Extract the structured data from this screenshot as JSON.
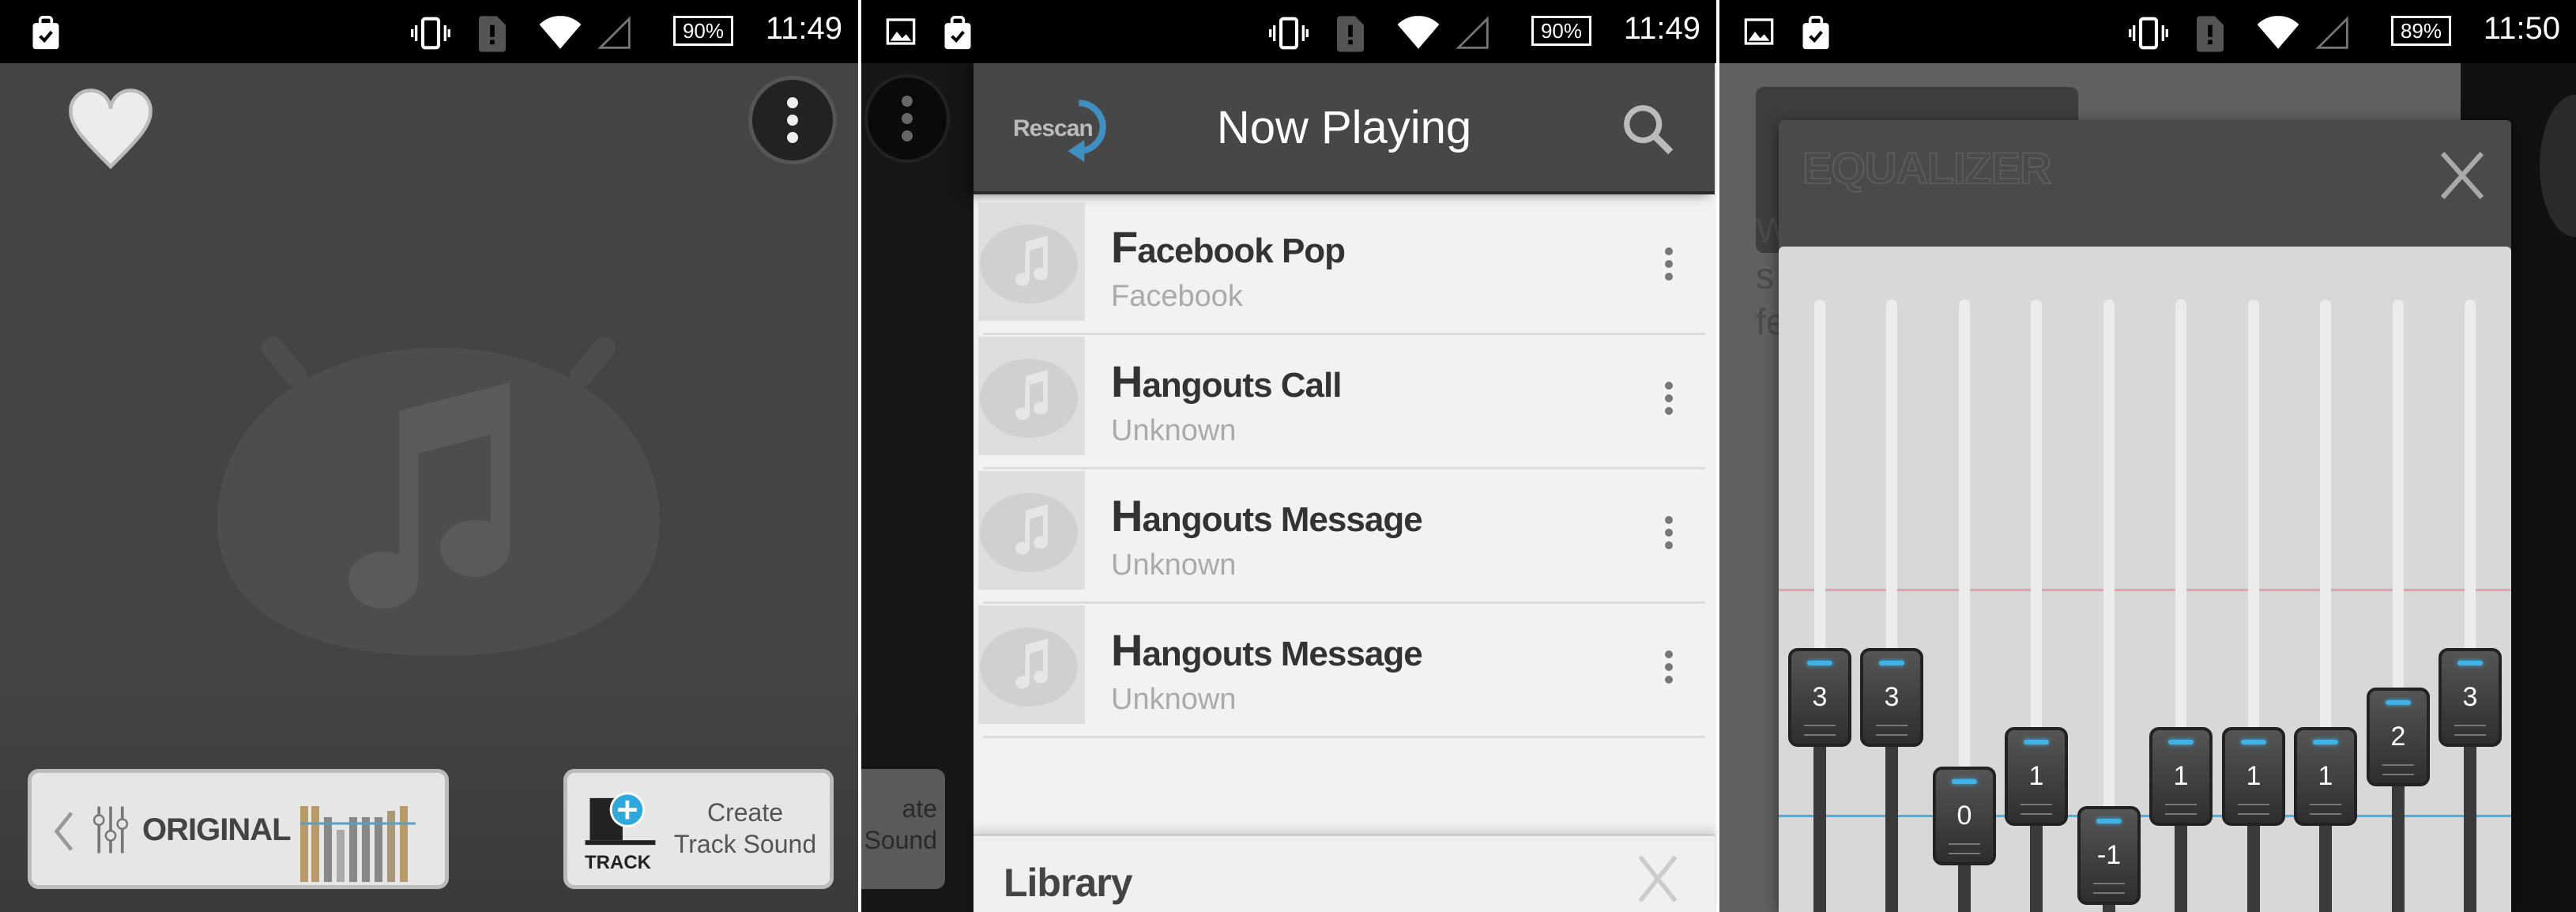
{
  "panels": [
    {
      "status": {
        "time": "11:49",
        "battery": "90%",
        "left_icons": [
          "clipboard-check-icon"
        ]
      }
    },
    {
      "status": {
        "time": "11:49",
        "battery": "90%",
        "left_icons": [
          "image-icon",
          "clipboard-check-icon"
        ]
      }
    },
    {
      "status": {
        "time": "11:50",
        "battery": "89%",
        "left_icons": [
          "image-icon",
          "clipboard-check-icon"
        ]
      }
    }
  ],
  "player": {
    "eq_preset": "ORIGINAL",
    "create_track_line1": "Create",
    "create_track_line2": "Track Sound",
    "track_badge": "TRACK",
    "ghost_line1": "ate",
    "ghost_line2": "Sound"
  },
  "now_playing": {
    "title": "Now Playing",
    "rescan": "Rescan",
    "tracks": [
      {
        "title": "Facebook Pop",
        "artist": "Facebook"
      },
      {
        "title": "Hangouts Call",
        "artist": "Unknown"
      },
      {
        "title": "Hangouts Message",
        "artist": "Unknown"
      },
      {
        "title": "Hangouts Message",
        "artist": "Unknown"
      }
    ],
    "library": "Library"
  },
  "equalizer": {
    "title": "EQUALIZER",
    "bands": [
      3,
      3,
      0,
      1,
      -1,
      1,
      1,
      1,
      2,
      3
    ],
    "bg_fragments": [
      "W",
      "s",
      "fe"
    ],
    "colors": {
      "knob_light": "#3fb3e8",
      "zero_line": "#3fb3e8",
      "upper_line": "#e8a0a8"
    }
  },
  "colors": {
    "accent": "#3fa6dc",
    "rescan_arrow": "#3f8fc0"
  }
}
